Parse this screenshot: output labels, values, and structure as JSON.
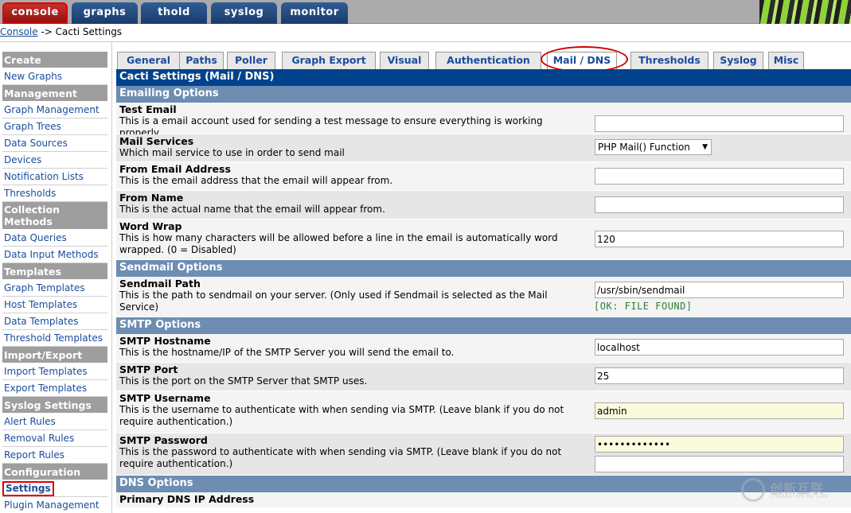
{
  "top_tabs": [
    "console",
    "graphs",
    "thold",
    "syslog",
    "monitor"
  ],
  "breadcrumb": {
    "link": "Console",
    "separator": " -> ",
    "current": "Cacti Settings"
  },
  "sidebar": {
    "create_head": "Create",
    "new_graphs": "New Graphs",
    "management_head": "Management",
    "graph_management": "Graph Management",
    "graph_trees": "Graph Trees",
    "data_sources": "Data Sources",
    "devices": "Devices",
    "notification_lists": "Notification Lists",
    "thresholds": "Thresholds",
    "collection_head_1": "Collection",
    "collection_head_2": "Methods",
    "data_queries": "Data Queries",
    "data_input_methods": "Data Input Methods",
    "templates_head": "Templates",
    "graph_templates": "Graph Templates",
    "host_templates": "Host Templates",
    "data_templates": "Data Templates",
    "threshold_templates": "Threshold Templates",
    "import_export_head": "Import/Export",
    "import_templates": "Import Templates",
    "export_templates": "Export Templates",
    "syslog_settings_head": "Syslog Settings",
    "alert_rules": "Alert Rules",
    "removal_rules": "Removal Rules",
    "report_rules": "Report Rules",
    "configuration_head": "Configuration",
    "settings": "Settings",
    "plugin_management": "Plugin Management"
  },
  "settings_tabs": [
    "General",
    "Paths",
    "Poller",
    "Graph Export",
    "Visual",
    "Authentication",
    "Mail / DNS",
    "Thresholds",
    "Syslog",
    "Misc"
  ],
  "main": {
    "title": "Cacti Settings (Mail / DNS)",
    "emailing_section": "Emailing Options",
    "test_email_label": "Test Email",
    "test_email_desc": "This is a email account used for sending a test message to ensure everything is working properly.",
    "test_email_value": "",
    "mail_services_label": "Mail Services",
    "mail_services_desc": "Which mail service to use in order to send mail",
    "mail_services_value": "PHP Mail() Function",
    "from_email_label": "From Email Address",
    "from_email_desc": "This is the email address that the email will appear from.",
    "from_email_value": "",
    "from_name_label": "From Name",
    "from_name_desc": "This is the actual name that the email will appear from.",
    "from_name_value": "",
    "word_wrap_label": "Word Wrap",
    "word_wrap_desc": "This is how many characters will be allowed before a line in the email is automatically word wrapped. (0 = Disabled)",
    "word_wrap_value": "120",
    "sendmail_section": "Sendmail Options",
    "sendmail_path_label": "Sendmail Path",
    "sendmail_path_desc": "This is the path to sendmail on your server. (Only used if Sendmail is selected as the Mail Service)",
    "sendmail_path_value": "/usr/sbin/sendmail",
    "sendmail_status": "[OK: FILE FOUND]",
    "smtp_section": "SMTP Options",
    "smtp_hostname_label": "SMTP Hostname",
    "smtp_hostname_desc": "This is the hostname/IP of the SMTP Server you will send the email to.",
    "smtp_hostname_value": "localhost",
    "smtp_port_label": "SMTP Port",
    "smtp_port_desc": "This is the port on the SMTP Server that SMTP uses.",
    "smtp_port_value": "25",
    "smtp_username_label": "SMTP Username",
    "smtp_username_desc": "This is the username to authenticate with when sending via SMTP. (Leave blank if you do not require authentication.)",
    "smtp_username_value": "admin",
    "smtp_password_label": "SMTP Password",
    "smtp_password_desc": "This is the password to authenticate with when sending via SMTP. (Leave blank if you do not require authentication.)",
    "smtp_password_value": "•••••••••••••",
    "smtp_password_confirm_value": "",
    "dns_section": "DNS Options",
    "primary_dns_label": "Primary DNS IP Address"
  },
  "watermark": {
    "text": "创新互联",
    "sub": "CHUANG XIN HU LIAN"
  },
  "colors": {
    "title_bar": "#00438c",
    "section_bar": "#6d8db3",
    "sidebar_head": "#9e9e9e",
    "link": "#1a4c9c",
    "highlight": "#e00000"
  }
}
